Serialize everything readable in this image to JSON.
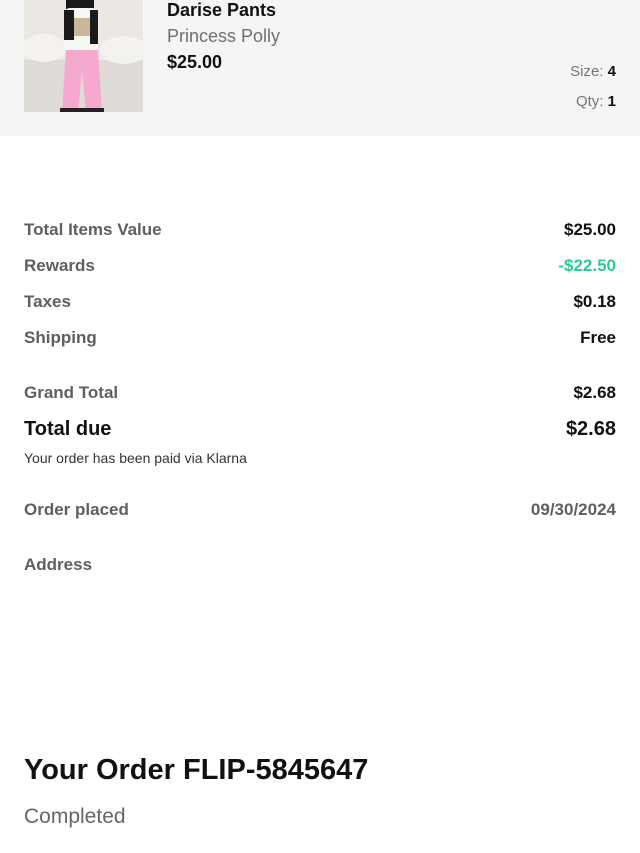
{
  "product": {
    "name": "Darise Pants",
    "brand": "Princess Polly",
    "price": "$25.00",
    "size_label": "Size:",
    "size_value": "4",
    "qty_label": "Qty:",
    "qty_value": "1"
  },
  "summary": {
    "total_items_label": "Total Items Value",
    "total_items_value": "$25.00",
    "rewards_label": "Rewards",
    "rewards_value": "-$22.50",
    "taxes_label": "Taxes",
    "taxes_value": "$0.18",
    "shipping_label": "Shipping",
    "shipping_value": "Free",
    "grand_total_label": "Grand Total",
    "grand_total_value": "$2.68",
    "total_due_label": "Total due",
    "total_due_value": "$2.68",
    "paid_note": "Your order has been paid via Klarna",
    "order_placed_label": "Order placed",
    "order_placed_value": "09/30/2024",
    "address_label": "Address"
  },
  "order": {
    "title": "Your Order FLIP-5845647",
    "status": "Completed"
  },
  "colors": {
    "discount": "#2ec99a",
    "card_background": "#f5f5f5"
  }
}
